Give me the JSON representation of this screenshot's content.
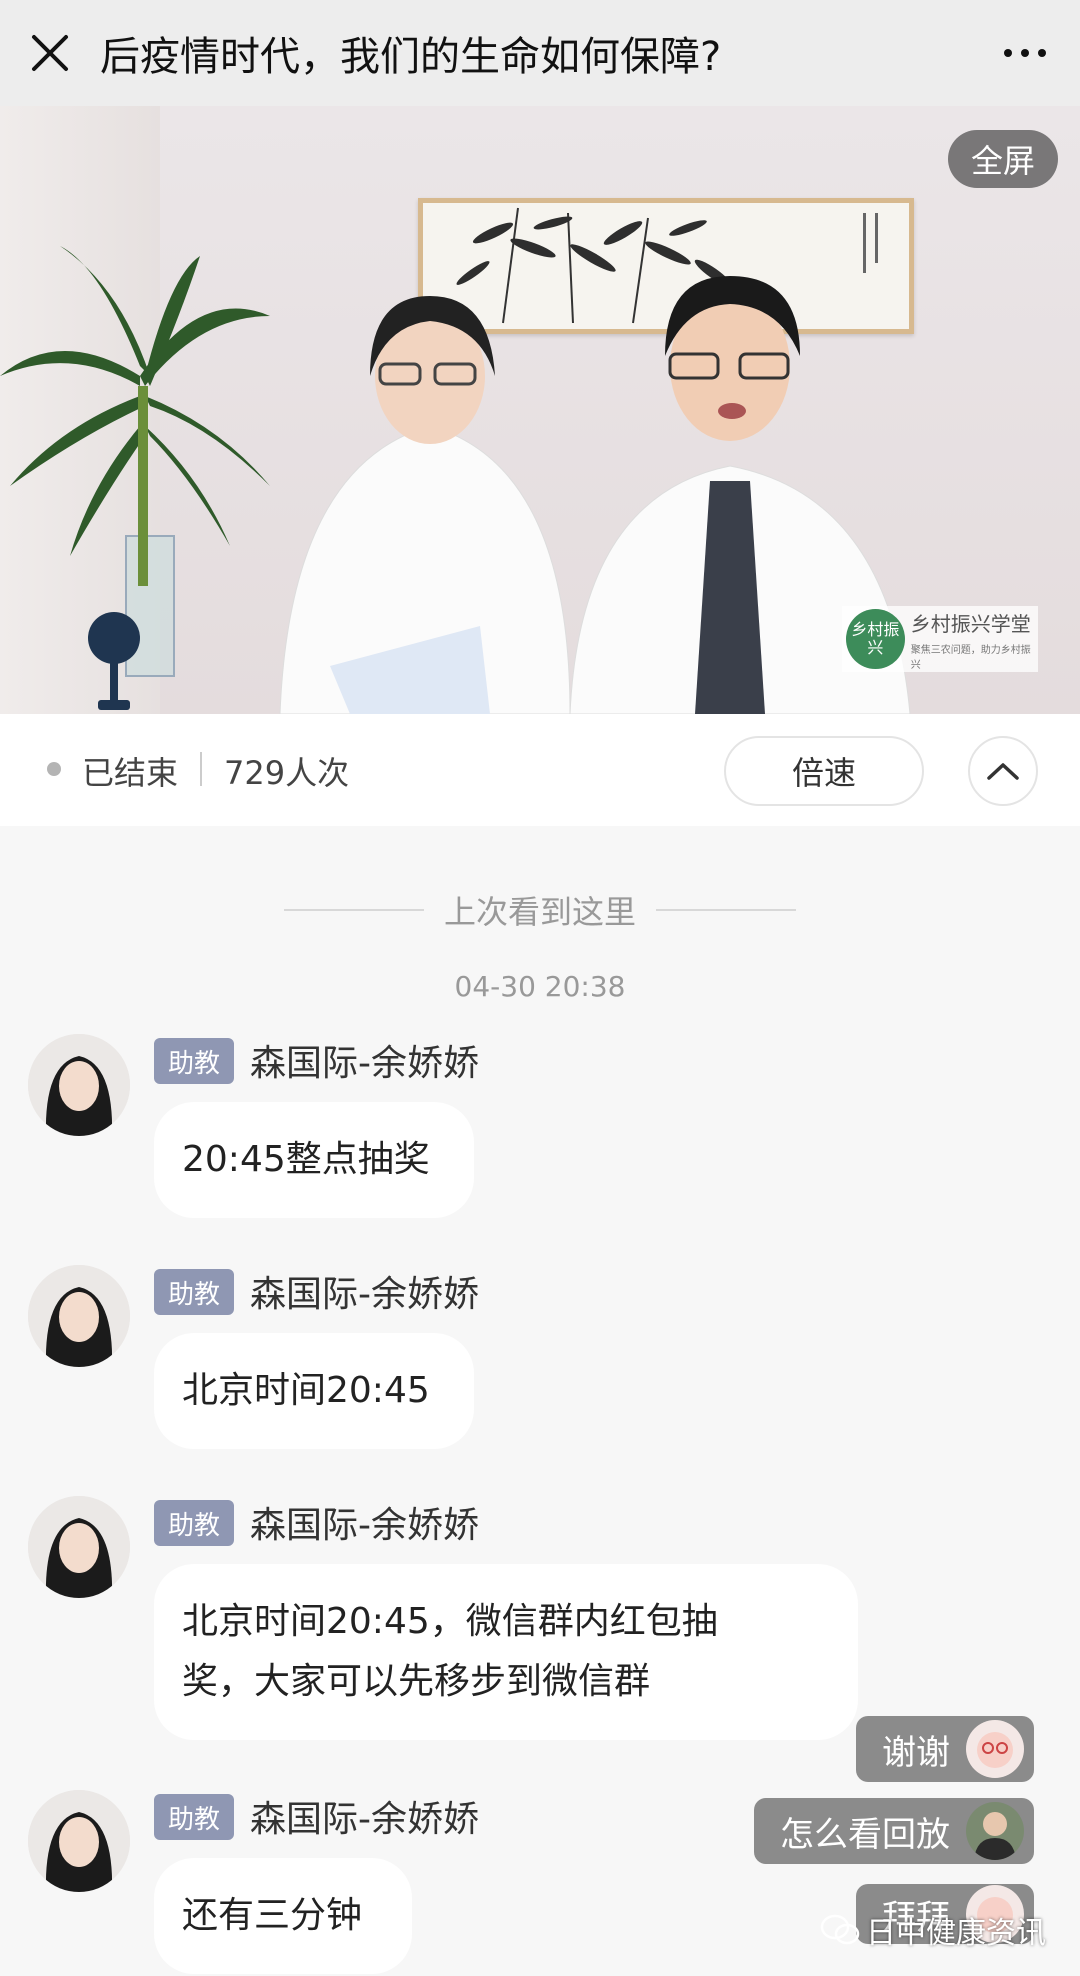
{
  "topbar": {
    "title": "后疫情时代，我们的生命如何保障?"
  },
  "video": {
    "fullscreen_label": "全屏",
    "logo_seal": "乡村振兴",
    "logo_main": "乡村振兴学堂",
    "logo_sub": "聚焦三农问题，助力乡村振兴"
  },
  "status": {
    "state": "已结束",
    "viewers": "729人次",
    "speed_label": "倍速"
  },
  "chat": {
    "divider": "上次看到这里",
    "timestamp": "04-30 20:38",
    "messages": [
      {
        "role": "助教",
        "sender": "森国际-余娇娇",
        "text_lines": [
          "20:45整点抽奖"
        ]
      },
      {
        "role": "助教",
        "sender": "森国际-余娇娇",
        "text_lines": [
          "北京时间20:45"
        ]
      },
      {
        "role": "助教",
        "sender": "森国际-余娇娇",
        "text_lines": [
          "北京时间20:45，微信群内红包抽",
          "奖，大家可以先移步到微信群"
        ]
      },
      {
        "role": "助教",
        "sender": "森国际-余娇娇",
        "text_lines": [
          "还有三分钟"
        ]
      }
    ]
  },
  "floating_comments": [
    {
      "text": "谢谢"
    },
    {
      "text": "怎么看回放"
    },
    {
      "text": "拜拜"
    }
  ],
  "watermark": "日中健康资讯",
  "colors": {
    "badge": "#8f97b3",
    "topbar_bg": "#ededed",
    "chat_bg": "#f7f7f7"
  }
}
